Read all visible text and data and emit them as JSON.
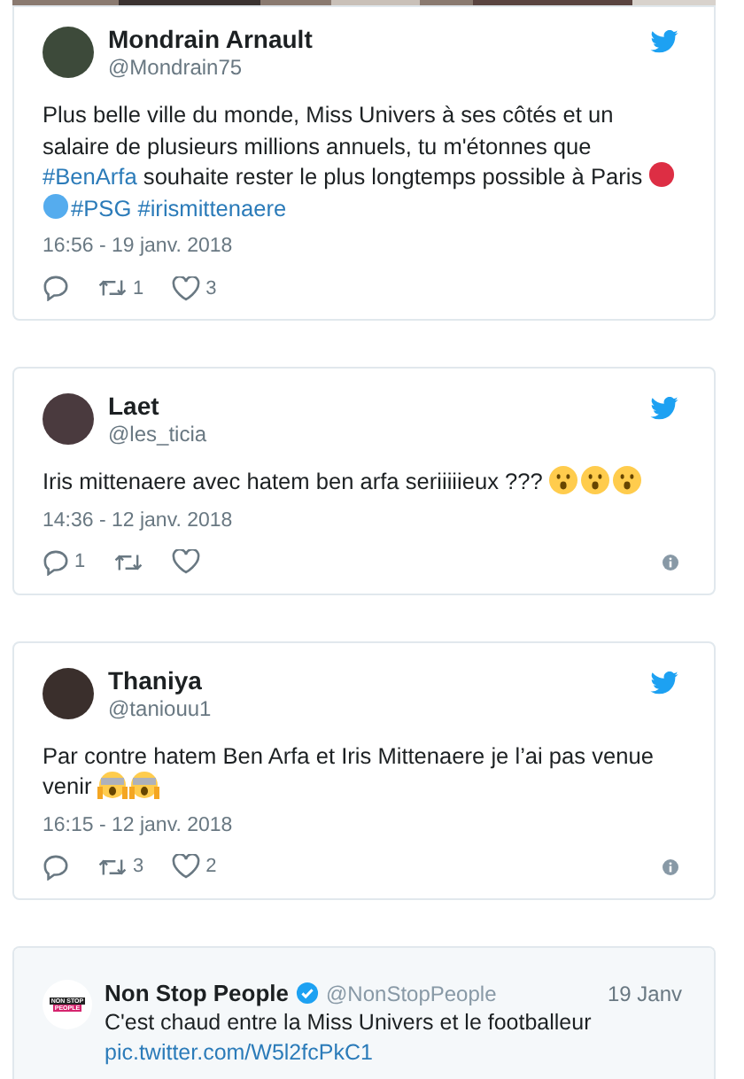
{
  "tweets": [
    {
      "name": "Mondrain Arnault",
      "handle": "@Mondrain75",
      "body": [
        {
          "kind": "text",
          "text": "Plus belle ville du monde, Miss Univers à ses côtés et un salaire de plusieurs millions annuels, tu m'étonnes que "
        },
        {
          "kind": "hashtag",
          "text": "#BenArfa"
        },
        {
          "kind": "text",
          "text": " souhaite rester le plus longtemps possible à Paris "
        },
        {
          "kind": "circle",
          "color": "#dd2e44"
        },
        {
          "kind": "circle",
          "color": "#55acee"
        },
        {
          "kind": "hashtag",
          "text": "#PSG"
        },
        {
          "kind": "hashtag",
          "text": "#irismittenaere"
        }
      ],
      "time": "16:56 - 19 janv. 2018",
      "retweets": "1",
      "likes": "3",
      "info": false
    },
    {
      "name": "Laet",
      "handle": "@les_ticia",
      "body": [
        {
          "kind": "text",
          "text": "Iris mittenaere avec hatem ben arfa seriiiiieux ??? "
        },
        {
          "kind": "astonished"
        },
        {
          "kind": "astonished"
        },
        {
          "kind": "astonished"
        }
      ],
      "time": "14:36 - 12 janv. 2018",
      "replies": "1",
      "info": true
    },
    {
      "name": "Thaniya",
      "handle": "@taniouu1",
      "body": [
        {
          "kind": "text",
          "text": "Par contre hatem Ben Arfa et Iris Mittenaere je l’ai pas venue venir "
        },
        {
          "kind": "scream"
        },
        {
          "kind": "scream"
        }
      ],
      "time": "16:15 - 12 janv. 2018",
      "retweets": "3",
      "likes": "2",
      "info": true
    }
  ],
  "quoted": {
    "logo_lines": [
      "NON STOP",
      "PEOPLE"
    ],
    "name": "Non Stop People",
    "verified": true,
    "handle": "@NonStopPeople",
    "date": "19 Janv",
    "text": "C'est chaud entre la Miss Univers et le footballeur",
    "link": "pic.twitter.com/W5l2fcPkC1"
  }
}
